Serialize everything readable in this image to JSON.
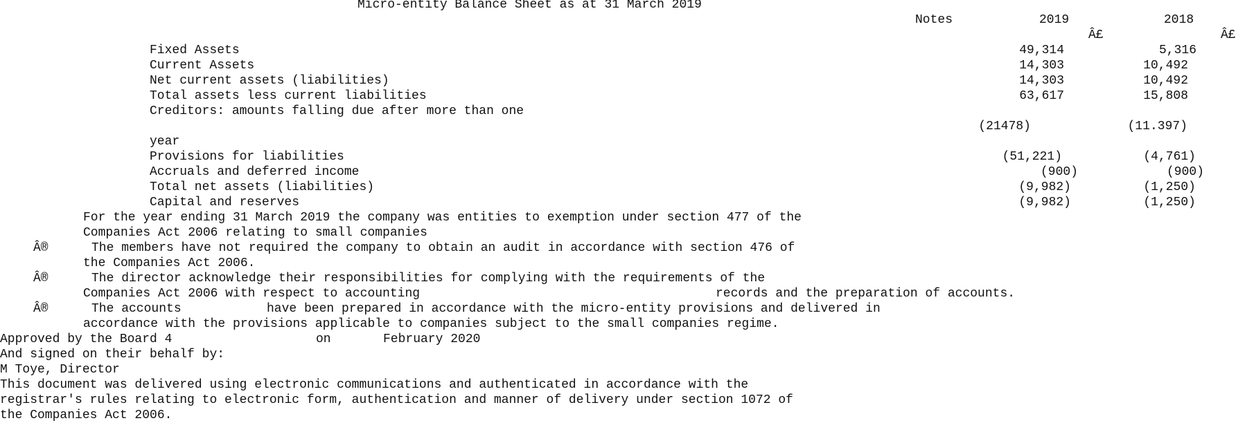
{
  "title": "Micro-entity Balance Sheet as at 31 March 2019",
  "columns": {
    "notes": "Notes",
    "year_current": "2019",
    "year_prior": "2018",
    "currency_current": "Â£",
    "currency_prior": "Â£"
  },
  "rows": [
    {
      "label": "Fixed Assets",
      "current": "49,314",
      "prior": "5,316"
    },
    {
      "label": "Current Assets",
      "current": "14,303",
      "prior": "10,492"
    },
    {
      "label": "Net current assets (liabilities)",
      "current": "14,303",
      "prior": "10,492"
    },
    {
      "label": "Total assets less current liabilities",
      "current": "63,617",
      "prior": "15,808"
    },
    {
      "label": "Creditors: amounts falling due after more than one",
      "label_cont": "year",
      "current": "(21478)",
      "prior": "(11.397)"
    },
    {
      "label": "Provisions for liabilities",
      "current": "(51,221)",
      "prior": "(4,761)"
    },
    {
      "label": "Accruals and deferred income",
      "current": "(900)",
      "prior": "(900)"
    },
    {
      "label": "Total net assets (liabilities)",
      "current": "(9,982)",
      "prior": "(1,250)"
    },
    {
      "label": "Capital and reserves",
      "current": "(9,982)",
      "prior": "(1,250)"
    }
  ],
  "statement": {
    "line1": "For the year ending 31 March 2019 the company was entities to exemption under section 477 of the",
    "line2": "Companies Act 2006 relating to small companies"
  },
  "bullets": [
    {
      "marker": "Â®",
      "line1": "The members have not required the company to obtain an audit in accordance with section 476 of",
      "line2": "the Companies Act 2006."
    },
    {
      "marker": "Â®",
      "line1": "The director acknowledge their responsibilities for complying with the requirements of the",
      "line2a": "Companies Act 2006 with respect to accounting",
      "line2b": "records and the preparation of accounts."
    },
    {
      "marker": "Â®",
      "line1a": "The accounts",
      "line1b": "have been prepared in accordance with the micro-entity provisions and delivered in",
      "line2": "accordance with the provisions applicable to companies subject to the small companies regime."
    }
  ],
  "approval": {
    "prefix": "Approved by the Board 4",
    "on": "on",
    "date": "February 2020",
    "signed": "And signed on their behalf by:",
    "signatory": "M Toye, Director"
  },
  "footer": {
    "line1": "This document was delivered using electronic communications and authenticated in accordance with the",
    "line2": "registrar's rules relating to electronic form, authentication and manner of delivery under section 1072 of",
    "line3": "the Companies Act 2006."
  }
}
